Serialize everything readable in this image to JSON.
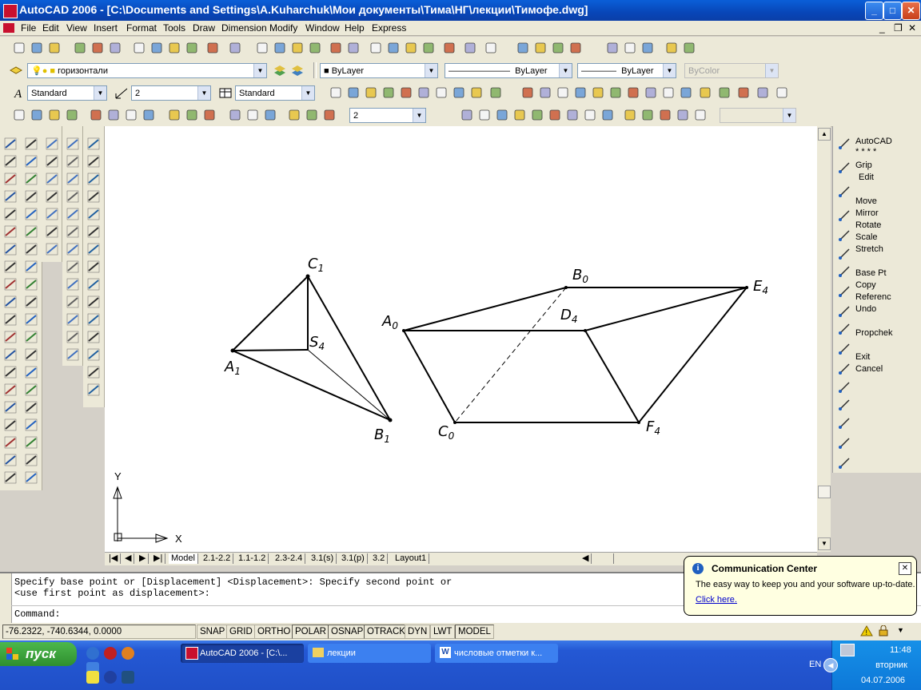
{
  "window": {
    "title": "AutoCAD 2006 - [C:\\Documents and Settings\\A.Kuharchuk\\Мои документы\\Тима\\НГ\\лекции\\Тимофе.dwg]"
  },
  "menu": [
    "File",
    "Edit",
    "View",
    "Insert",
    "Format",
    "Tools",
    "Draw",
    "Dimension",
    "Modify",
    "Window",
    "Help",
    "Express"
  ],
  "properties": {
    "layer": "горизонтали",
    "color": "ByLayer",
    "linetype": "ByLayer",
    "lineweight": "ByLayer",
    "plotstyle": "ByColor"
  },
  "styles": {
    "text_style": "Standard",
    "dim_scale": "2",
    "dim_style": "Standard"
  },
  "dim_toolbar": {
    "scale": "2"
  },
  "drawing": {
    "labels": {
      "C1": "C",
      "C1_sub": "1",
      "S4": "S",
      "S4_sub": "4",
      "A1": "A",
      "A1_sub": "1",
      "B1": "B",
      "B1_sub": "1",
      "A0": "A",
      "A0_sub": "0",
      "B0": "B",
      "B0_sub": "0",
      "D4": "D",
      "D4_sub": "4",
      "E4": "E",
      "E4_sub": "4",
      "C0": "C",
      "C0_sub": "0",
      "F4": "F",
      "F4_sub": "4"
    },
    "ucs": {
      "x": "X",
      "y": "Y"
    }
  },
  "layout_tabs": [
    "Model",
    "2.1-2.2",
    "1.1-1.2",
    "2.3-2.4",
    "3.1(s)",
    "3.1(p)",
    "3.2",
    "Layout1"
  ],
  "grip_menu": [
    "AutoCAD",
    "* * * *",
    "Grip",
    "Edit",
    "Move",
    "Mirror",
    "Rotate",
    "Scale",
    "Stretch",
    "Base Pt",
    "Copy",
    "Referenc",
    "Undo",
    "Propchek",
    "Exit",
    "Cancel"
  ],
  "command": {
    "line1": "Specify base point or [Displacement] <Displacement>: Specify second point or",
    "line2": "<use first point as displacement>:",
    "prompt": "Command:"
  },
  "status": {
    "coords": "-76.2322, -740.6344, 0.0000",
    "buttons": [
      "SNAP",
      "GRID",
      "ORTHO",
      "POLAR",
      "OSNAP",
      "OTRACK",
      "DYN",
      "LWT",
      "MODEL"
    ]
  },
  "balloon": {
    "title": "Communication Center",
    "text": "The easy way to keep you and your software up-to-date.",
    "link": "Click here."
  },
  "taskbar": {
    "start": "пуск",
    "tasks": [
      "AutoCAD 2006 - [C:\\...",
      "лекции",
      "числовые отметки к..."
    ],
    "lang": "EN",
    "time": "11:48",
    "day": "вторник",
    "date": "04.07.2006"
  },
  "colors": {
    "title": "#0a5fd8",
    "taskbar": "#2458d4",
    "start": "#3a9a3a"
  }
}
